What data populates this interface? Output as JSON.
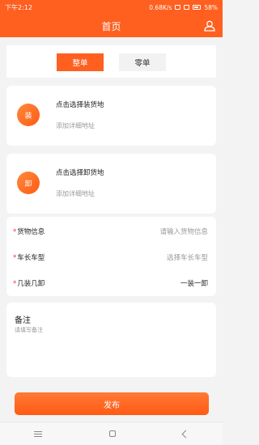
{
  "status_bar": {
    "time": "下午2:12",
    "network_speed": "0.68K/s",
    "battery": "58%"
  },
  "header": {
    "title": "首页",
    "icons": {
      "user": "user-icon"
    }
  },
  "tabs": [
    {
      "label": "整单",
      "active": true
    },
    {
      "label": "零单",
      "active": false
    }
  ],
  "addresses": {
    "load": {
      "badge": "装",
      "title": "点击选择装货地",
      "detail_placeholder": "添加详细地址"
    },
    "unload": {
      "badge": "卸",
      "title": "点击选择卸货地",
      "detail_placeholder": "添加详细地址"
    }
  },
  "form": {
    "required_mark": "*",
    "cargo": {
      "label": "货物信息",
      "placeholder": "请输入货物信息"
    },
    "truck": {
      "label": "车长车型",
      "placeholder": "选择车长车型"
    },
    "stops": {
      "label": "几装几卸",
      "value": "一装一卸"
    }
  },
  "remark": {
    "title": "备注",
    "placeholder": "请填写备注"
  },
  "actions": {
    "publish": "发布"
  },
  "colors": {
    "accent": "#ff5f1f",
    "page_bg": "#f3f3f3",
    "placeholder": "#999999"
  }
}
